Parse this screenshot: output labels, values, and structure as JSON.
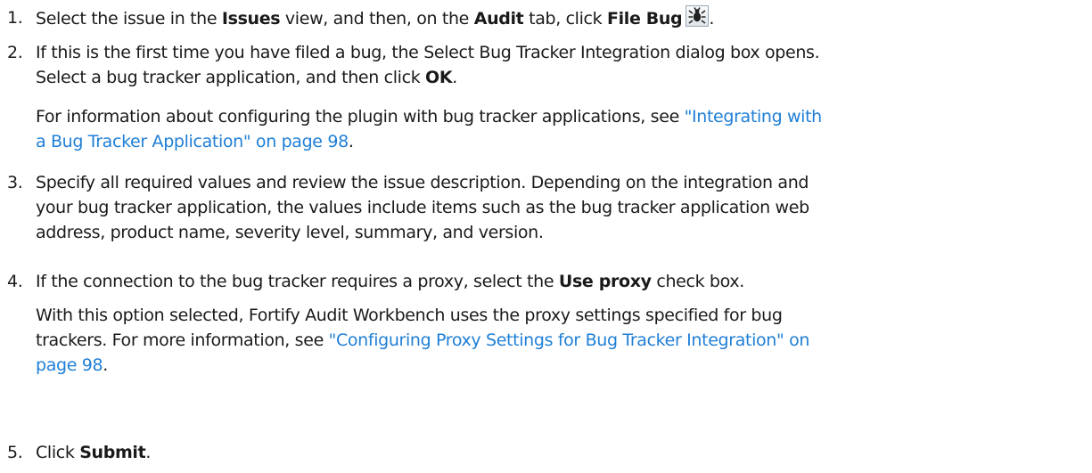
{
  "steps": [
    {
      "number": "1.",
      "text_a": "Select the issue in the ",
      "bold_a": "Issues",
      "text_b": " view, and then, on the ",
      "bold_b": "Audit",
      "text_c": " tab, click ",
      "bold_c": "File Bug",
      "icon": "bug-icon",
      "text_d": "."
    },
    {
      "number": "2.",
      "line1": "If this is the first time you have filed a bug, the Select Bug Tracker Integration dialog box opens.",
      "line2_text": "Select a bug tracker application, and then click ",
      "line2_bold": "OK",
      "line2_end": ".",
      "sub_text": "For information about configuring the plugin with bug tracker applications, see ",
      "sub_link_line1": "\"Integrating with",
      "sub_link_line2": "a Bug Tracker Application\" on page 98",
      "sub_end": "."
    },
    {
      "number": "3.",
      "line1": "Specify all required values and review the issue description. Depending on the integration and",
      "line2": "your bug tracker application, the values include items such as the bug tracker application web",
      "line3": "address, product name, severity level, summary, and version."
    },
    {
      "number": "4.",
      "text_a": "If the connection to the bug tracker requires a proxy, select the ",
      "bold_a": "Use proxy",
      "text_b": " check box.",
      "sub_line1": "With this option selected, Fortify Audit Workbench uses the proxy settings specified for bug",
      "sub_line2_text": "trackers. For more information, see ",
      "sub_link_line1": "\"Configuring Proxy Settings for Bug Tracker Integration\" on",
      "sub_link_line2": "page 98",
      "sub_end": "."
    },
    {
      "number": "5.",
      "text_a": "Click ",
      "bold_a": "Submit",
      "text_b": "."
    }
  ],
  "colors": {
    "link": "#1f7fd6",
    "text": "#1a1a1a"
  }
}
